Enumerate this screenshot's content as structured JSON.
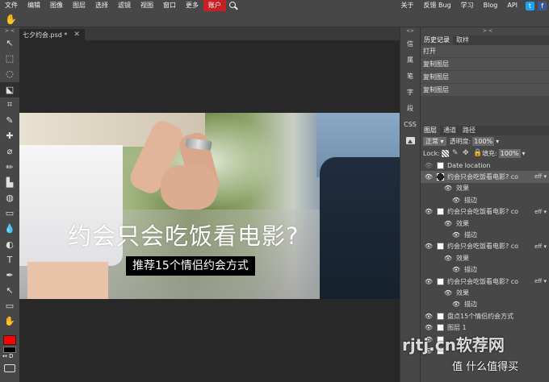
{
  "menu": {
    "items": [
      "文件",
      "编辑",
      "图像",
      "图层",
      "选择",
      "滤镜",
      "视图",
      "窗口",
      "更多",
      "账户"
    ],
    "active_index": 9,
    "right_items": [
      "关于",
      "反馈 Bug",
      "学习",
      "Blog",
      "API"
    ],
    "social": [
      "t",
      "f"
    ]
  },
  "options": {
    "tool_icon": "hand-icon"
  },
  "toolbar": {
    "arrows": "> <",
    "tools": [
      "↖",
      "⬚",
      "◌",
      "⬕",
      "⌗",
      "✎",
      "✚",
      "⌀",
      "✏",
      "▙",
      "◍",
      "▭",
      "💧",
      "◐",
      "T",
      "✒",
      "↖",
      "▭",
      "✋",
      "⌕"
    ],
    "foreground_color": "#ff0000",
    "background_color": "#000000",
    "swap_label": "↔ D"
  },
  "document": {
    "tab_title": "七夕约会.psd *",
    "close_glyph": "✕",
    "headline": "约会只会吃饭看电影?",
    "subline": "推荐15个情侣约会方式"
  },
  "mini_panel": {
    "arrows": "<>",
    "items": [
      "信",
      "属",
      "笔",
      "字",
      "段",
      "CSS"
    ]
  },
  "right_panel": {
    "arrows": "> <",
    "history_tabs": [
      "历史记录",
      "取样"
    ],
    "history": [
      "打开",
      "复制图层",
      "复制图层",
      "复制图层"
    ],
    "layers_tabs": [
      "图层",
      "通道",
      "路径"
    ],
    "blend_mode": "正常",
    "opacity_label": "透明度:",
    "opacity_value": "100%",
    "lock_label": "Lock:",
    "fill_label": "填充:",
    "fill_value": "100%",
    "layers": [
      {
        "type": "layer",
        "name": "Date location",
        "visible": false
      },
      {
        "type": "layer",
        "name": "约会只会吃饭看电影? co",
        "visible": true,
        "selected": true,
        "eff": "eff",
        "dashed": true
      },
      {
        "type": "sub",
        "name": "效果"
      },
      {
        "type": "sub",
        "name": "描边"
      },
      {
        "type": "layer",
        "name": "约会只会吃饭看电影? co",
        "visible": true,
        "eff": "eff"
      },
      {
        "type": "sub",
        "name": "效果"
      },
      {
        "type": "sub",
        "name": "描边"
      },
      {
        "type": "layer",
        "name": "约会只会吃饭看电影? co",
        "visible": true,
        "eff": "eff"
      },
      {
        "type": "sub",
        "name": "效果"
      },
      {
        "type": "sub",
        "name": "描边"
      },
      {
        "type": "layer",
        "name": "约会只会吃饭看电影? co",
        "visible": true,
        "eff": "eff"
      },
      {
        "type": "sub",
        "name": "效果"
      },
      {
        "type": "sub",
        "name": "描边"
      },
      {
        "type": "layer",
        "name": "盘点15个情侣约会方式",
        "visible": true
      },
      {
        "type": "layer",
        "name": "图层 1",
        "visible": true
      },
      {
        "type": "layer",
        "name": "",
        "visible": true
      },
      {
        "type": "layer",
        "name": "",
        "visible": true
      }
    ]
  },
  "watermark": {
    "text": "rjtj.cn软荐网",
    "sub": "值 什么值得买"
  }
}
